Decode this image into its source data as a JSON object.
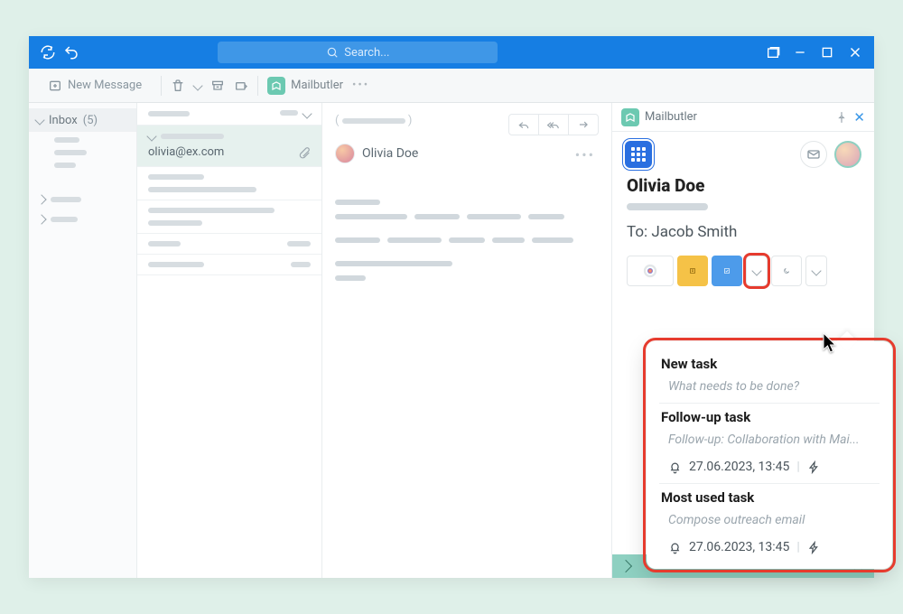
{
  "titlebar": {
    "search_placeholder": "Search..."
  },
  "toolbar": {
    "new_message_label": "New Message",
    "mailbutler_label": "Mailbutler"
  },
  "folders": {
    "inbox_label": "Inbox",
    "inbox_count": "(5)"
  },
  "message_list": {
    "selected_sender": "olivia@ex.com"
  },
  "message": {
    "contact_name": "Olivia Doe"
  },
  "side_panel": {
    "title": "Mailbutler",
    "contact_name": "Olivia Doe",
    "to_label": "To:",
    "to_name": "Jacob Smith",
    "popover": {
      "new_task_title": "New task",
      "new_task_placeholder": "What needs to be done?",
      "followup_title": "Follow-up task",
      "followup_desc": "Follow-up: Collaboration with Mai...",
      "followup_date": "27.06.2023, 13:45",
      "most_used_title": "Most used task",
      "most_used_desc": "Compose outreach email",
      "most_used_date": "27.06.2023, 13:45"
    }
  }
}
